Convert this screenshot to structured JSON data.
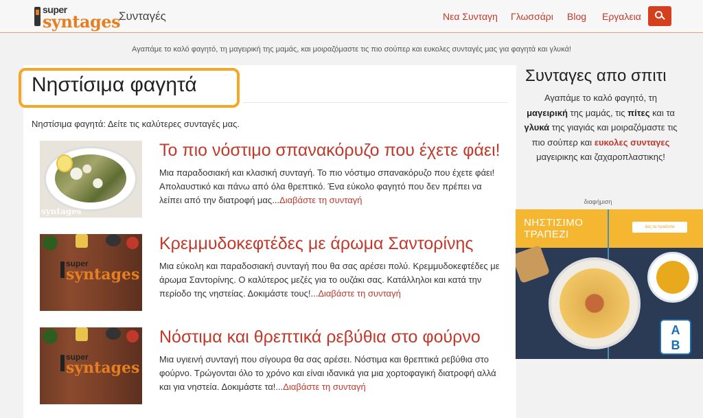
{
  "nav": {
    "logo_top": "super",
    "logo_bottom": "syntages",
    "brand": "Συνταγές",
    "links": [
      "Νεα Συνταγη",
      "Γλωσσάρι",
      "Blog",
      "Εργαλεια"
    ]
  },
  "tagline": "Αγαπάμε το καλό φαγητό, τη μαγειρική της μαμάς, και μοιραζόμαστε τις πιο σούπερ και ευκολες συνταγές μας για φαγητά και γλυκά!",
  "main": {
    "title": "Νηστίσιμα φαγητά",
    "intro": "Νηστίσιμα φαγητά: Δείτε τις καλύτερες συνταγές μας.",
    "read_more": "Διαβάστε τη συνταγή",
    "articles": [
      {
        "title": "Το πιο νόστιμο σπανακόρυζο που έχετε φάει!",
        "desc": "Μια παραδοσιακή και κλασική συνταγή. Το πιο νόστιμο σπανακόρυζο που έχετε φάει! Απολαυστικό και πάνω από όλα θρεπτικό. Ένα εύκολο φαγητό που δεν πρέπει να λείπει από την διατροφή μας...",
        "thumb_watermark": "syntages"
      },
      {
        "title": "Κρεμμυδοκεφτέδες με άρωμα Σαντορίνης",
        "desc": "Μια εύκολη και παραδοσιακή συνταγή που θα σας αρέσει πολύ. Κρεμμυδοκεφτέδες με άρωμα Σαντορίνης. Ο καλύτερος μεζές για το ουζάκι σας. Κατάλληλοι και κατά την περίοδο της νηστείας. Δοκιμάστε τους!...",
        "thumb_logo_top": "super",
        "thumb_logo_bottom": "syntages"
      },
      {
        "title": "Νόστιμα και θρεπτικά ρεβύθια στο φούρνο",
        "desc": "Μια υγιεινή συνταγή που σίγουρα θα σας αρέσει. Νόστιμα και θρεπτικά ρεβύθια στο φούρνο. Τρώγονται όλο το χρόνο και είναι ιδανικά για μια χορτοφαγική διατροφή αλλά και για νηστεία. Δοκιμάστε τα!...",
        "thumb_logo_top": "super",
        "thumb_logo_bottom": "syntages"
      }
    ]
  },
  "sidebar": {
    "title": "Συνταγες απο σπιτι",
    "text_parts": {
      "a": "Αγαπάμε το καλό φαγητό, τη ",
      "b": "μαγειρική",
      "c": " της μαμάς, τις ",
      "d": "πίτες",
      "e": " και τα ",
      "f": "γλυκά",
      "g": " της γιαγιάς και μοιραζόμαστε τις πιο σούπερ και ",
      "h": "ευκολες συνταγες",
      "i": " μαγειρικης και ζαχαροπλαστικης!"
    },
    "ad_label": "διαφήμιση",
    "ad": {
      "headline": "ΝΗΣΤΙΣΙΜΟ\nΤΡΑΠΕΖΙ",
      "button": "Δες τα προϊόντα",
      "brand_top": "A",
      "brand_bottom": "B"
    }
  },
  "colors": {
    "accent": "#c0392b",
    "brand_orange": "#e67e22",
    "highlight": "#f5a623",
    "search_button": "#d43f1d"
  }
}
